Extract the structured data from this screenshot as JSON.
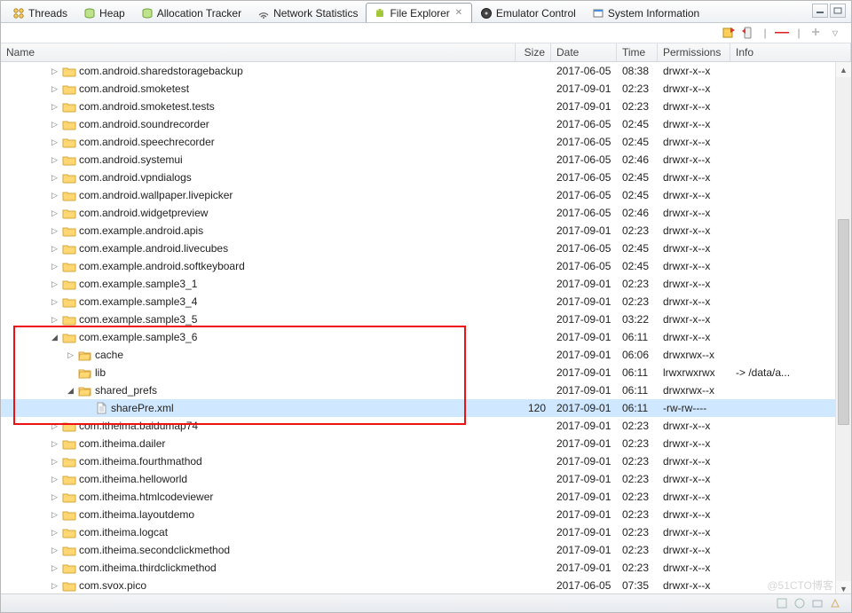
{
  "tabs": [
    {
      "label": "Threads",
      "icon": "threads"
    },
    {
      "label": "Heap",
      "icon": "db"
    },
    {
      "label": "Allocation Tracker",
      "icon": "db"
    },
    {
      "label": "Network Statistics",
      "icon": "wifi"
    },
    {
      "label": "File Explorer",
      "icon": "android",
      "active": true,
      "closable": true
    },
    {
      "label": "Emulator Control",
      "icon": "disc"
    },
    {
      "label": "System Information",
      "icon": "sys"
    }
  ],
  "columns": {
    "name": "Name",
    "size": "Size",
    "date": "Date",
    "time": "Time",
    "perm": "Permissions",
    "info": "Info"
  },
  "rows": [
    {
      "indent": 0,
      "exp": "closed",
      "kind": "folder",
      "name": "com.android.sharedstoragebackup",
      "size": "",
      "date": "2017-06-05",
      "time": "08:38",
      "perm": "drwxr-x--x",
      "info": ""
    },
    {
      "indent": 0,
      "exp": "closed",
      "kind": "folder",
      "name": "com.android.smoketest",
      "size": "",
      "date": "2017-09-01",
      "time": "02:23",
      "perm": "drwxr-x--x",
      "info": ""
    },
    {
      "indent": 0,
      "exp": "closed",
      "kind": "folder",
      "name": "com.android.smoketest.tests",
      "size": "",
      "date": "2017-09-01",
      "time": "02:23",
      "perm": "drwxr-x--x",
      "info": ""
    },
    {
      "indent": 0,
      "exp": "closed",
      "kind": "folder",
      "name": "com.android.soundrecorder",
      "size": "",
      "date": "2017-06-05",
      "time": "02:45",
      "perm": "drwxr-x--x",
      "info": ""
    },
    {
      "indent": 0,
      "exp": "closed",
      "kind": "folder",
      "name": "com.android.speechrecorder",
      "size": "",
      "date": "2017-06-05",
      "time": "02:45",
      "perm": "drwxr-x--x",
      "info": ""
    },
    {
      "indent": 0,
      "exp": "closed",
      "kind": "folder",
      "name": "com.android.systemui",
      "size": "",
      "date": "2017-06-05",
      "time": "02:46",
      "perm": "drwxr-x--x",
      "info": ""
    },
    {
      "indent": 0,
      "exp": "closed",
      "kind": "folder",
      "name": "com.android.vpndialogs",
      "size": "",
      "date": "2017-06-05",
      "time": "02:45",
      "perm": "drwxr-x--x",
      "info": ""
    },
    {
      "indent": 0,
      "exp": "closed",
      "kind": "folder",
      "name": "com.android.wallpaper.livepicker",
      "size": "",
      "date": "2017-06-05",
      "time": "02:45",
      "perm": "drwxr-x--x",
      "info": ""
    },
    {
      "indent": 0,
      "exp": "closed",
      "kind": "folder",
      "name": "com.android.widgetpreview",
      "size": "",
      "date": "2017-06-05",
      "time": "02:46",
      "perm": "drwxr-x--x",
      "info": ""
    },
    {
      "indent": 0,
      "exp": "closed",
      "kind": "folder",
      "name": "com.example.android.apis",
      "size": "",
      "date": "2017-09-01",
      "time": "02:23",
      "perm": "drwxr-x--x",
      "info": ""
    },
    {
      "indent": 0,
      "exp": "closed",
      "kind": "folder",
      "name": "com.example.android.livecubes",
      "size": "",
      "date": "2017-06-05",
      "time": "02:45",
      "perm": "drwxr-x--x",
      "info": ""
    },
    {
      "indent": 0,
      "exp": "closed",
      "kind": "folder",
      "name": "com.example.android.softkeyboard",
      "size": "",
      "date": "2017-06-05",
      "time": "02:45",
      "perm": "drwxr-x--x",
      "info": ""
    },
    {
      "indent": 0,
      "exp": "closed",
      "kind": "folder",
      "name": "com.example.sample3_1",
      "size": "",
      "date": "2017-09-01",
      "time": "02:23",
      "perm": "drwxr-x--x",
      "info": ""
    },
    {
      "indent": 0,
      "exp": "closed",
      "kind": "folder",
      "name": "com.example.sample3_4",
      "size": "",
      "date": "2017-09-01",
      "time": "02:23",
      "perm": "drwxr-x--x",
      "info": ""
    },
    {
      "indent": 0,
      "exp": "closed",
      "kind": "folder",
      "name": "com.example.sample3_5",
      "size": "",
      "date": "2017-09-01",
      "time": "03:22",
      "perm": "drwxr-x--x",
      "info": ""
    },
    {
      "indent": 0,
      "exp": "open",
      "kind": "folder",
      "name": "com.example.sample3_6",
      "size": "",
      "date": "2017-09-01",
      "time": "06:11",
      "perm": "drwxr-x--x",
      "info": ""
    },
    {
      "indent": 1,
      "exp": "closed",
      "kind": "folder-o",
      "name": "cache",
      "size": "",
      "date": "2017-09-01",
      "time": "06:06",
      "perm": "drwxrwx--x",
      "info": ""
    },
    {
      "indent": 1,
      "exp": "none",
      "kind": "folder-o",
      "name": "lib",
      "size": "",
      "date": "2017-09-01",
      "time": "06:11",
      "perm": "lrwxrwxrwx",
      "info": "-> /data/a..."
    },
    {
      "indent": 1,
      "exp": "open",
      "kind": "folder-o",
      "name": "shared_prefs",
      "size": "",
      "date": "2017-09-01",
      "time": "06:11",
      "perm": "drwxrwx--x",
      "info": ""
    },
    {
      "indent": 2,
      "exp": "none",
      "kind": "file",
      "name": "sharePre.xml",
      "size": "120",
      "date": "2017-09-01",
      "time": "06:11",
      "perm": "-rw-rw----",
      "info": "",
      "selected": true
    },
    {
      "indent": 0,
      "exp": "closed",
      "kind": "folder",
      "name": "com.itheima.baidumap74",
      "size": "",
      "date": "2017-09-01",
      "time": "02:23",
      "perm": "drwxr-x--x",
      "info": ""
    },
    {
      "indent": 0,
      "exp": "closed",
      "kind": "folder",
      "name": "com.itheima.dailer",
      "size": "",
      "date": "2017-09-01",
      "time": "02:23",
      "perm": "drwxr-x--x",
      "info": ""
    },
    {
      "indent": 0,
      "exp": "closed",
      "kind": "folder",
      "name": "com.itheima.fourthmathod",
      "size": "",
      "date": "2017-09-01",
      "time": "02:23",
      "perm": "drwxr-x--x",
      "info": ""
    },
    {
      "indent": 0,
      "exp": "closed",
      "kind": "folder",
      "name": "com.itheima.helloworld",
      "size": "",
      "date": "2017-09-01",
      "time": "02:23",
      "perm": "drwxr-x--x",
      "info": ""
    },
    {
      "indent": 0,
      "exp": "closed",
      "kind": "folder",
      "name": "com.itheima.htmlcodeviewer",
      "size": "",
      "date": "2017-09-01",
      "time": "02:23",
      "perm": "drwxr-x--x",
      "info": ""
    },
    {
      "indent": 0,
      "exp": "closed",
      "kind": "folder",
      "name": "com.itheima.layoutdemo",
      "size": "",
      "date": "2017-09-01",
      "time": "02:23",
      "perm": "drwxr-x--x",
      "info": ""
    },
    {
      "indent": 0,
      "exp": "closed",
      "kind": "folder",
      "name": "com.itheima.logcat",
      "size": "",
      "date": "2017-09-01",
      "time": "02:23",
      "perm": "drwxr-x--x",
      "info": ""
    },
    {
      "indent": 0,
      "exp": "closed",
      "kind": "folder",
      "name": "com.itheima.secondclickmethod",
      "size": "",
      "date": "2017-09-01",
      "time": "02:23",
      "perm": "drwxr-x--x",
      "info": ""
    },
    {
      "indent": 0,
      "exp": "closed",
      "kind": "folder",
      "name": "com.itheima.thirdclickmethod",
      "size": "",
      "date": "2017-09-01",
      "time": "02:23",
      "perm": "drwxr-x--x",
      "info": ""
    },
    {
      "indent": 0,
      "exp": "closed",
      "kind": "folder",
      "name": "com.svox.pico",
      "size": "",
      "date": "2017-06-05",
      "time": "07:35",
      "perm": "drwxr-x--x",
      "info": ""
    }
  ],
  "redbox_row_start": 15,
  "redbox_row_end": 20,
  "watermark": "@51CTO博客"
}
